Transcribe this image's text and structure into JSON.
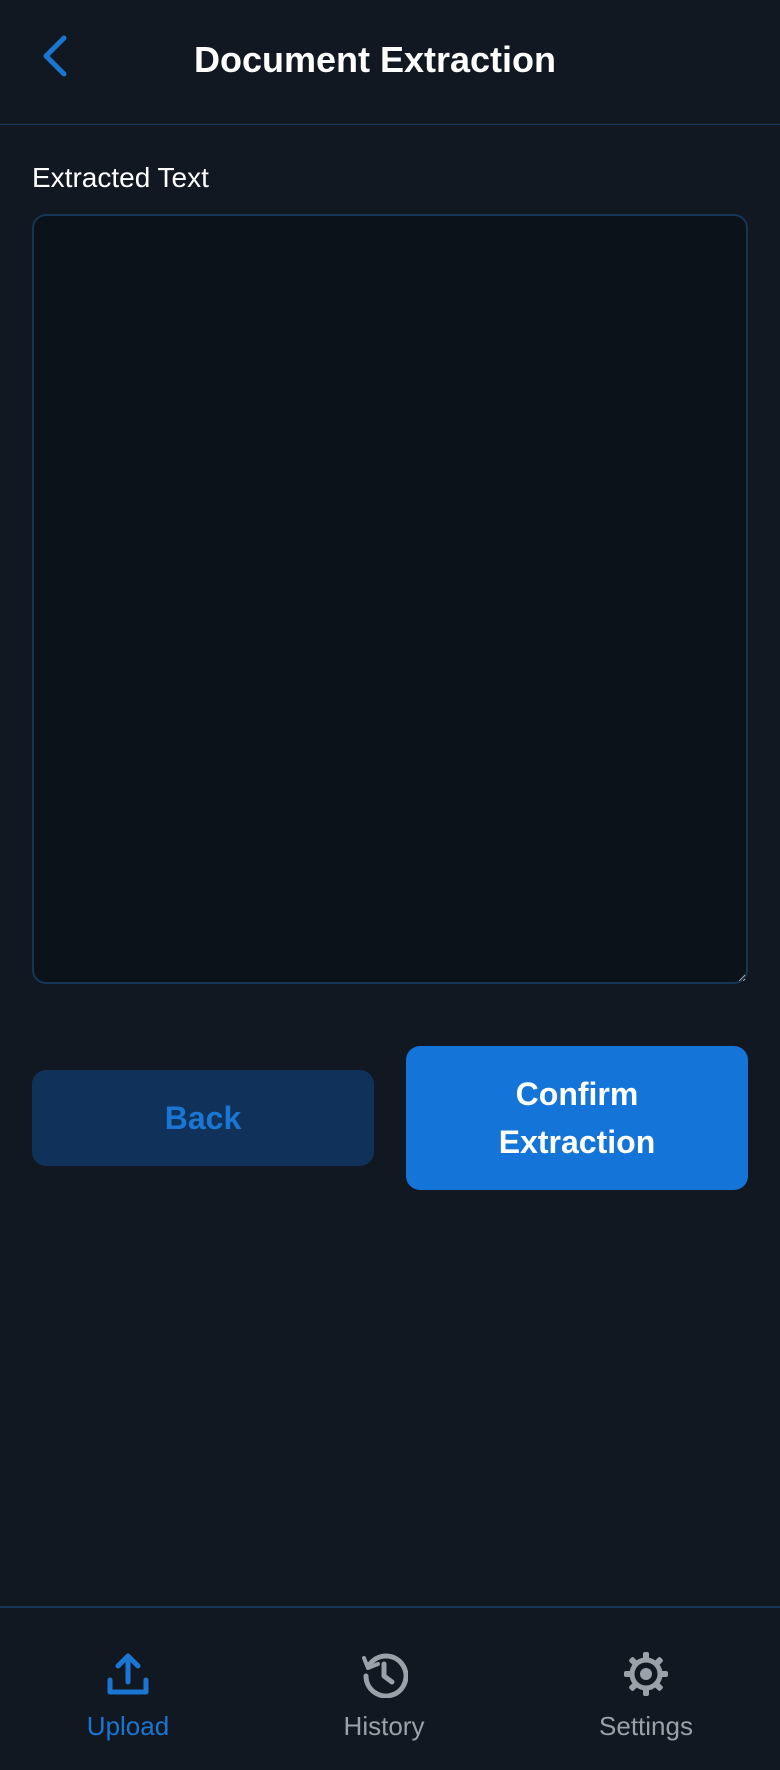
{
  "header": {
    "title": "Document Extraction",
    "back_icon": "chevron-left-icon"
  },
  "form": {
    "label": "Extracted Text",
    "value": ""
  },
  "actions": {
    "back_label": "Back",
    "confirm_label": "Confirm Extraction"
  },
  "bottom_nav": {
    "items": [
      {
        "label": "Upload",
        "icon": "upload-icon",
        "active": true
      },
      {
        "label": "History",
        "icon": "history-icon",
        "active": false
      },
      {
        "label": "Settings",
        "icon": "gear-icon",
        "active": false
      }
    ]
  },
  "colors": {
    "background": "#111821",
    "accent": "#1a76d2",
    "primary_button": "#1474d8",
    "secondary_button": "#10325a",
    "inactive": "#9aa1a9"
  }
}
